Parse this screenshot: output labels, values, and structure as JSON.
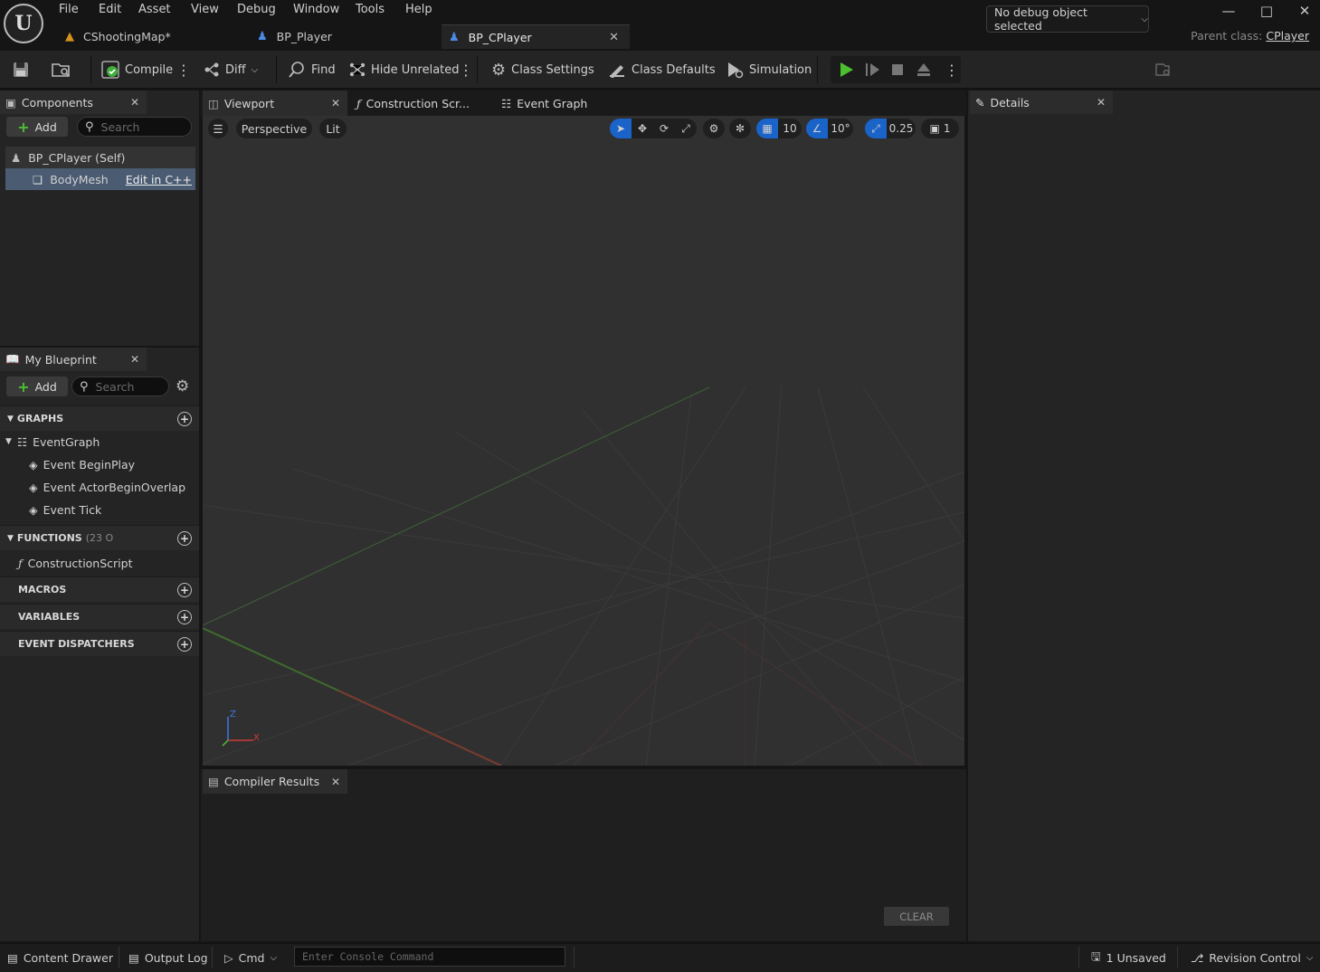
{
  "menu": [
    "File",
    "Edit",
    "Asset",
    "View",
    "Debug",
    "Window",
    "Tools",
    "Help"
  ],
  "doc_tabs": [
    {
      "label": "CShootingMap*"
    },
    {
      "label": "BP_Player"
    },
    {
      "label": "BP_CPlayer"
    }
  ],
  "parent_class": {
    "label": "Parent class:",
    "value": "CPlayer"
  },
  "toolbar": {
    "compile": "Compile",
    "diff": "Diff",
    "find": "Find",
    "hide_unrelated": "Hide Unrelated",
    "class_settings": "Class Settings",
    "class_defaults": "Class Defaults",
    "simulation": "Simulation",
    "debug_object": "No debug object selected"
  },
  "components": {
    "tab": "Components",
    "add": "Add",
    "search_placeholder": "Search",
    "root": "BP_CPlayer (Self)",
    "child": "BodyMesh",
    "edit_cpp": "Edit in C++"
  },
  "my_blueprint": {
    "tab": "My Blueprint",
    "add": "Add",
    "search_placeholder": "Search",
    "graphs_header": "GRAPHS",
    "event_graph": "EventGraph",
    "events": [
      "Event BeginPlay",
      "Event ActorBeginOverlap",
      "Event Tick"
    ],
    "functions_header": "FUNCTIONS",
    "functions_count": "(23 O",
    "construction_script": "ConstructionScript",
    "macros_header": "MACROS",
    "variables_header": "VARIABLES",
    "dispatchers_header": "EVENT DISPATCHERS"
  },
  "editor_tabs": {
    "viewport": "Viewport",
    "construction": "Construction Scr...",
    "event_graph": "Event Graph"
  },
  "viewport": {
    "perspective": "Perspective",
    "lit": "Lit",
    "grid_snap": "10",
    "rotation_snap": "10°",
    "scale_snap": "0.25",
    "camera_speed": "1",
    "axis_z": "Z",
    "axis_x": "X"
  },
  "details": {
    "tab": "Details"
  },
  "compiler": {
    "tab": "Compiler Results",
    "clear": "CLEAR"
  },
  "statusbar": {
    "content_drawer": "Content Drawer",
    "output_log": "Output Log",
    "cmd": "Cmd",
    "console_placeholder": "Enter Console Command",
    "unsaved": "1 Unsaved",
    "revision_control": "Revision Control"
  },
  "colors": {
    "accent": "#1a63c9",
    "play": "#4cbf2f",
    "bg": "#151515",
    "panel": "#242424",
    "viewport": "#303030"
  }
}
